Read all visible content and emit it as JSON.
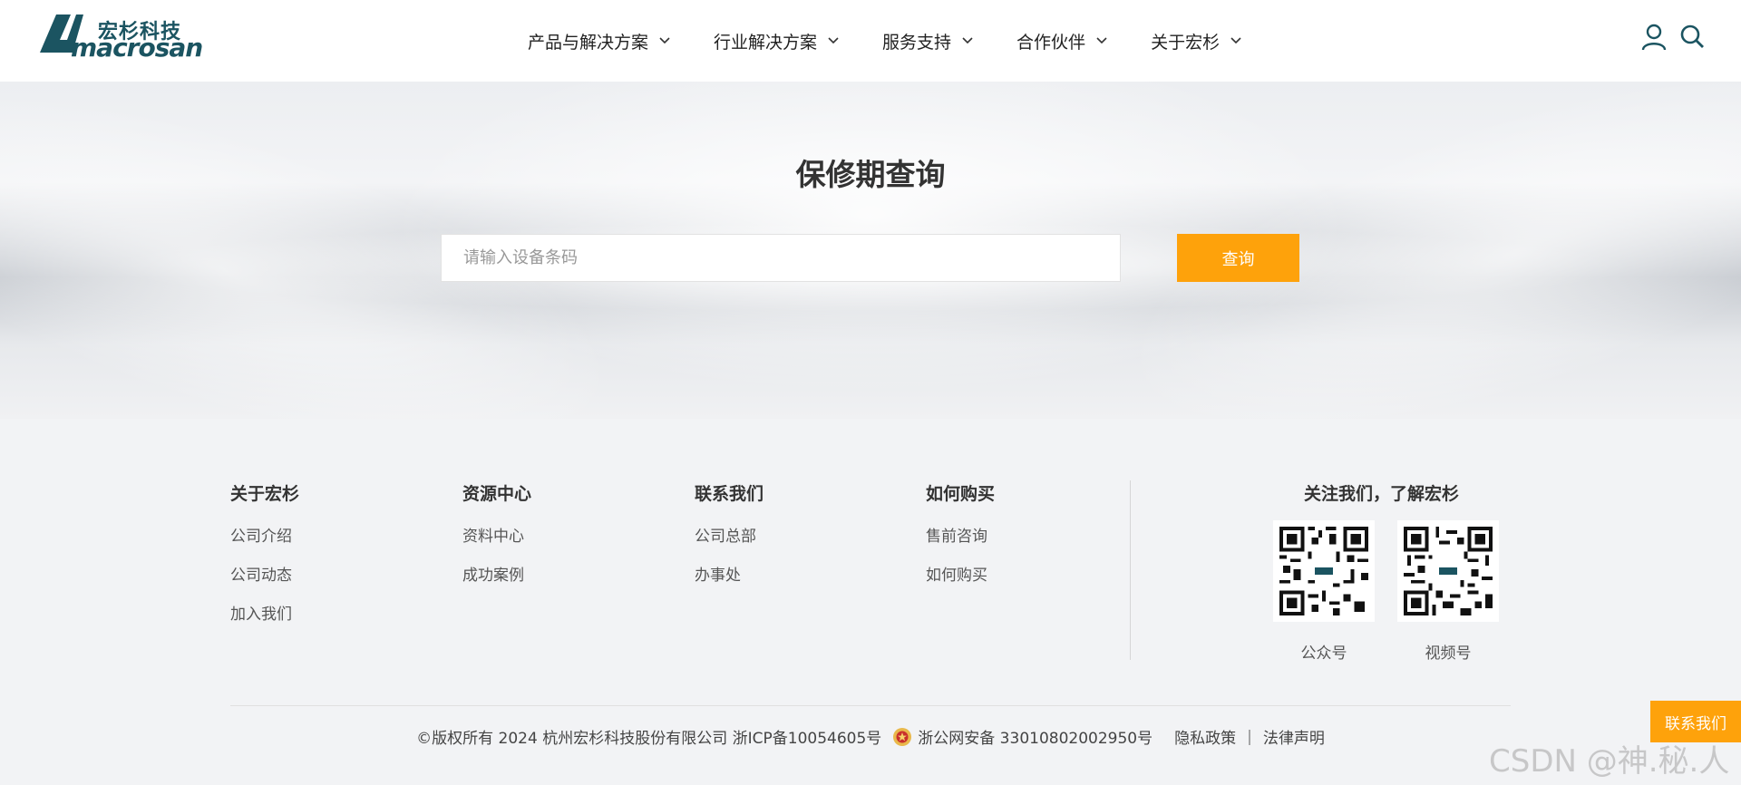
{
  "header": {
    "logo_cn": "宏杉科技",
    "logo_en": "macrosan",
    "nav": [
      {
        "label": "产品与解决方案"
      },
      {
        "label": "行业解决方案"
      },
      {
        "label": "服务支持"
      },
      {
        "label": "合作伙伴"
      },
      {
        "label": "关于宏杉"
      }
    ],
    "icons": [
      "user-icon",
      "search-icon"
    ]
  },
  "hero": {
    "title": "保修期查询",
    "search_placeholder": "请输入设备条码",
    "search_value": "",
    "search_button": "查询"
  },
  "footer": {
    "columns": [
      {
        "title": "关于宏杉",
        "links": [
          "公司介绍",
          "公司动态",
          "加入我们"
        ]
      },
      {
        "title": "资源中心",
        "links": [
          "资料中心",
          "成功案例"
        ]
      },
      {
        "title": "联系我们",
        "links": [
          "公司总部",
          "办事处"
        ]
      },
      {
        "title": "如何购买",
        "links": [
          "售前咨询",
          "如何购买"
        ]
      }
    ],
    "follow_title": "关注我们，了解宏杉",
    "qr_codes": [
      {
        "label": "公众号"
      },
      {
        "label": "视频号"
      }
    ],
    "copyright": "©版权所有 2024 杭州宏杉科技股份有限公司 浙ICP备10054605号",
    "police_record": "浙公网安备 33010802002950号",
    "privacy_link": "隐私政策",
    "legal_link": "法律声明",
    "contact_button": "联系我们"
  },
  "watermark": "CSDN @神.秘.人",
  "colors": {
    "accent": "#fea20b",
    "brand": "#1b5461"
  }
}
